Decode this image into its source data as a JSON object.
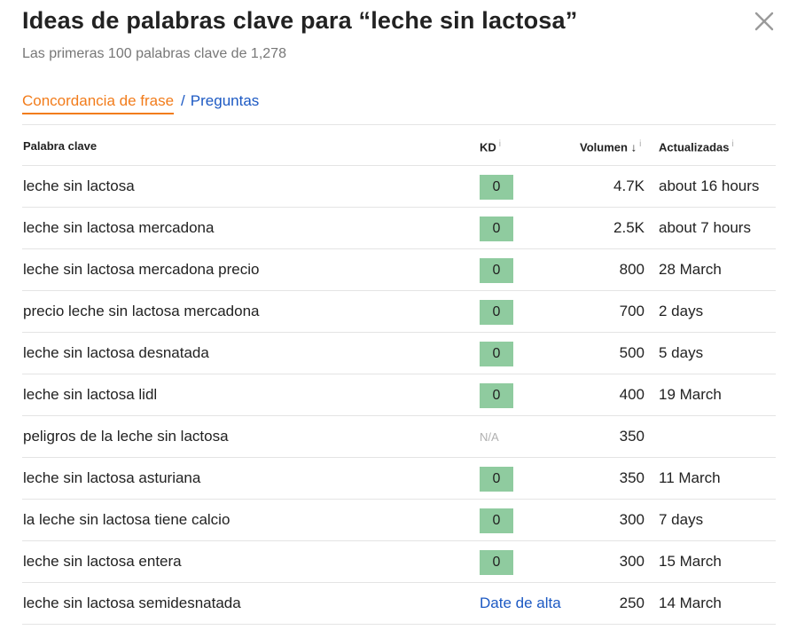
{
  "header": {
    "title": "Ideas de palabras clave para “leche sin lactosa”",
    "subtitle": "Las primeras 100 palabras clave de 1,278",
    "close_icon": "close-icon"
  },
  "tabs": {
    "active": "Concordancia de frase",
    "separator": "/",
    "other": "Preguntas"
  },
  "table": {
    "columns": {
      "keyword": "Palabra clave",
      "kd": "KD",
      "volume": "Volumen",
      "volume_sort_icon": "↓",
      "updated": "Actualizadas",
      "info_icon": "i"
    },
    "rows": [
      {
        "keyword": "leche sin lactosa",
        "kd": "0",
        "kd_type": "badge",
        "volume": "4.7K",
        "updated": "about 16 hours"
      },
      {
        "keyword": "leche sin lactosa mercadona",
        "kd": "0",
        "kd_type": "badge",
        "volume": "2.5K",
        "updated": "about 7 hours"
      },
      {
        "keyword": "leche sin lactosa mercadona precio",
        "kd": "0",
        "kd_type": "badge",
        "volume": "800",
        "updated": "28 March"
      },
      {
        "keyword": "precio leche sin lactosa mercadona",
        "kd": "0",
        "kd_type": "badge",
        "volume": "700",
        "updated": "2 days"
      },
      {
        "keyword": "leche sin lactosa desnatada",
        "kd": "0",
        "kd_type": "badge",
        "volume": "500",
        "updated": "5 days"
      },
      {
        "keyword": "leche sin lactosa lidl",
        "kd": "0",
        "kd_type": "badge",
        "volume": "400",
        "updated": "19 March"
      },
      {
        "keyword": "peligros de la leche sin lactosa",
        "kd": "N/A",
        "kd_type": "na",
        "volume": "350",
        "updated": ""
      },
      {
        "keyword": "leche sin lactosa asturiana",
        "kd": "0",
        "kd_type": "badge",
        "volume": "350",
        "updated": "11 March"
      },
      {
        "keyword": "la leche sin lactosa tiene calcio",
        "kd": "0",
        "kd_type": "badge",
        "volume": "300",
        "updated": "7 days"
      },
      {
        "keyword": "leche sin lactosa entera",
        "kd": "0",
        "kd_type": "badge",
        "volume": "300",
        "updated": "15 March"
      },
      {
        "keyword": "leche sin lactosa semidesnatada",
        "kd": "Date de alta",
        "kd_type": "link",
        "volume": "250",
        "updated": "14 March"
      }
    ]
  },
  "colors": {
    "accent_orange": "#f27c1b",
    "link_blue": "#1c59c3",
    "kd_green": "#8fcb9f"
  }
}
